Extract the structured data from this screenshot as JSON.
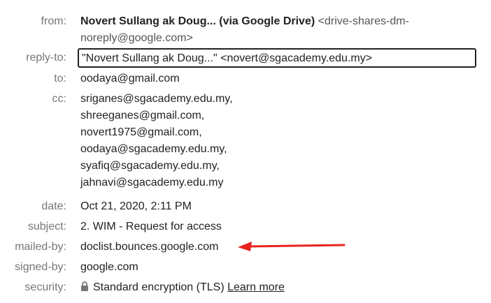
{
  "from": {
    "label": "from:",
    "name": "Novert Sullang ak Doug... (via Google Drive)",
    "email_part1": "<drive-shares-dm-",
    "email_part2": "noreply@google.com>"
  },
  "reply_to": {
    "label": "reply-to:",
    "value": "\"Novert Sullang ak Doug...\" <novert@sgacademy.edu.my>"
  },
  "to": {
    "label": "to:",
    "value": "oodaya@gmail.com"
  },
  "cc": {
    "label": "cc:",
    "recipients": [
      "sriganes@sgacademy.edu.my,",
      "shreeganes@gmail.com,",
      "novert1975@gmail.com,",
      "oodaya@sgacademy.edu.my,",
      "syafiq@sgacademy.edu.my,",
      "jahnavi@sgacademy.edu.my"
    ]
  },
  "date": {
    "label": "date:",
    "value": "Oct 21, 2020, 2:11 PM"
  },
  "subject": {
    "label": "subject:",
    "value": "2. WIM - Request for access"
  },
  "mailed_by": {
    "label": "mailed-by:",
    "value": "doclist.bounces.google.com"
  },
  "signed_by": {
    "label": "signed-by:",
    "value": "google.com"
  },
  "security": {
    "label": "security:",
    "icon": "lock-icon",
    "value": "Standard encryption (TLS)",
    "link": "Learn more"
  },
  "colors": {
    "label": "#777777",
    "text": "#222222",
    "arrow": "#e8231f"
  }
}
